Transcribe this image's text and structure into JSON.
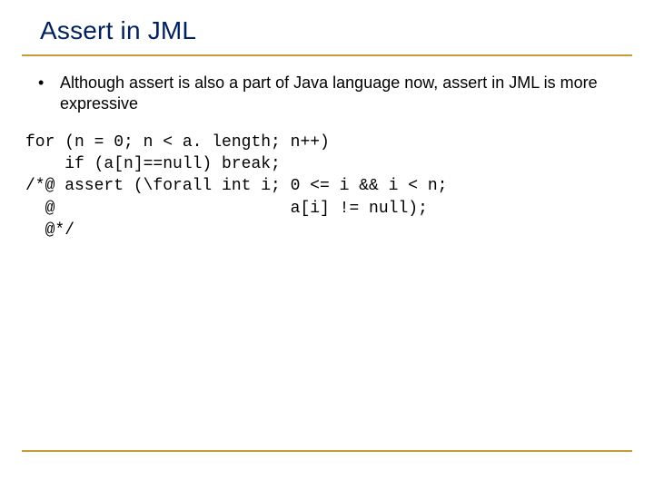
{
  "title": "Assert in JML",
  "bullets": [
    "Although assert is also a part of Java language now, assert in JML is more expressive"
  ],
  "code": [
    "for (n = 0; n < a. length; n++)",
    "    if (a[n]==null) break;",
    "/*@ assert (\\forall int i; 0 <= i && i < n;",
    "  @                        a[i] != null);",
    "  @*/"
  ],
  "colors": {
    "title": "#002060",
    "rule": "#c89a3a",
    "text": "#000000",
    "background": "#ffffff"
  }
}
